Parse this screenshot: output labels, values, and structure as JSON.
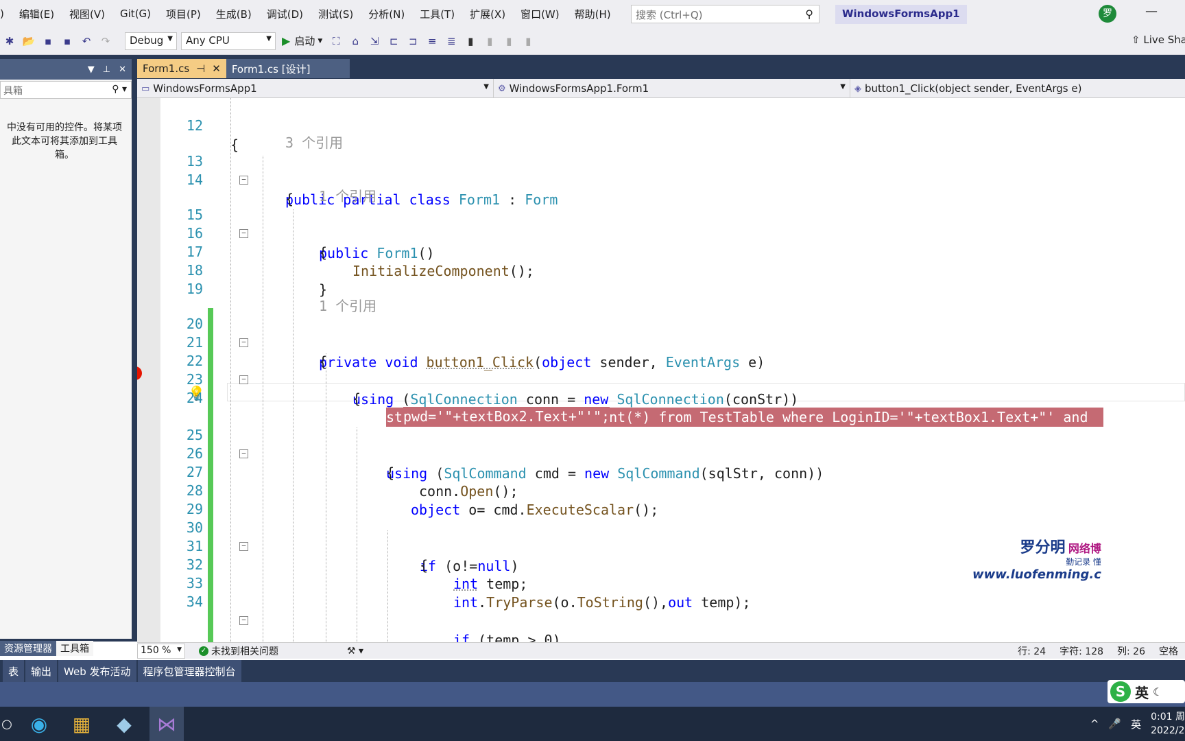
{
  "menu": [
    "编辑(E)",
    "视图(V)",
    "Git(G)",
    "项目(P)",
    "生成(B)",
    "调试(D)",
    "测试(S)",
    "分析(N)",
    "工具(T)",
    "扩展(X)",
    "窗口(W)",
    "帮助(H)"
  ],
  "menu_partial": ")",
  "search": {
    "placeholder": "搜索 (Ctrl+Q)"
  },
  "app_title": "WindowsFormsApp1",
  "avatar": "罗",
  "toolbar": {
    "config": "Debug",
    "platform": "Any CPU",
    "start": "启动",
    "liveshare": "Live Sha"
  },
  "left_panel": {
    "search_text": "具箱",
    "message": "中没有可用的控件。将某项\n此文本可将其添加到工具\n箱。",
    "tabs": [
      "资源管理器",
      "工具箱"
    ]
  },
  "tabs": [
    {
      "label": "Form1.cs",
      "active": true
    },
    {
      "label": "Form1.cs [设计]",
      "active": false
    }
  ],
  "nav": {
    "project": "WindowsFormsApp1",
    "class": "WindowsFormsApp1.Form1",
    "member": "button1_Click(object sender, EventArgs e)"
  },
  "code": {
    "l12": "12",
    "l13": "13",
    "l14": "14",
    "l15": "15",
    "l16": "16",
    "l17": "17",
    "l18": "18",
    "l19": "19",
    "l20": "20",
    "l21": "21",
    "l22": "22",
    "l23": "23",
    "l24": "24",
    "l25": "25",
    "l26": "26",
    "l27": "27",
    "l28": "28",
    "l29": "29",
    "l30": "30",
    "l31": "31",
    "l32": "32",
    "l33": "33",
    "l34": "34",
    "ref3": "3 个引用",
    "ref1a": "1 个引用",
    "ref1b": "1 个引用",
    "sql_line1": "string sqlStr = \"select count(*) from TestTable where LoginID='\"+textBox1.Text+\"' and ",
    "sql_line2": "pwd='\"+textBox2.Text+\"'\";"
  },
  "watermark": {
    "name": "罗分明",
    "blog": "网络博",
    "tag": "勤记录 懂",
    "url": "www.luofenming.c"
  },
  "status": {
    "zoom": "150 %",
    "issues": "未找到相关问题",
    "row": "行: 24",
    "char": "字符: 128",
    "col": "列: 26",
    "space": "空格"
  },
  "bottom_tabs": [
    "表",
    "输出",
    "Web 发布活动",
    "程序包管理器控制台"
  ],
  "tray": {
    "lang": "英",
    "time": "0:01 周",
    "date": "2022/2",
    "ime": "英"
  }
}
